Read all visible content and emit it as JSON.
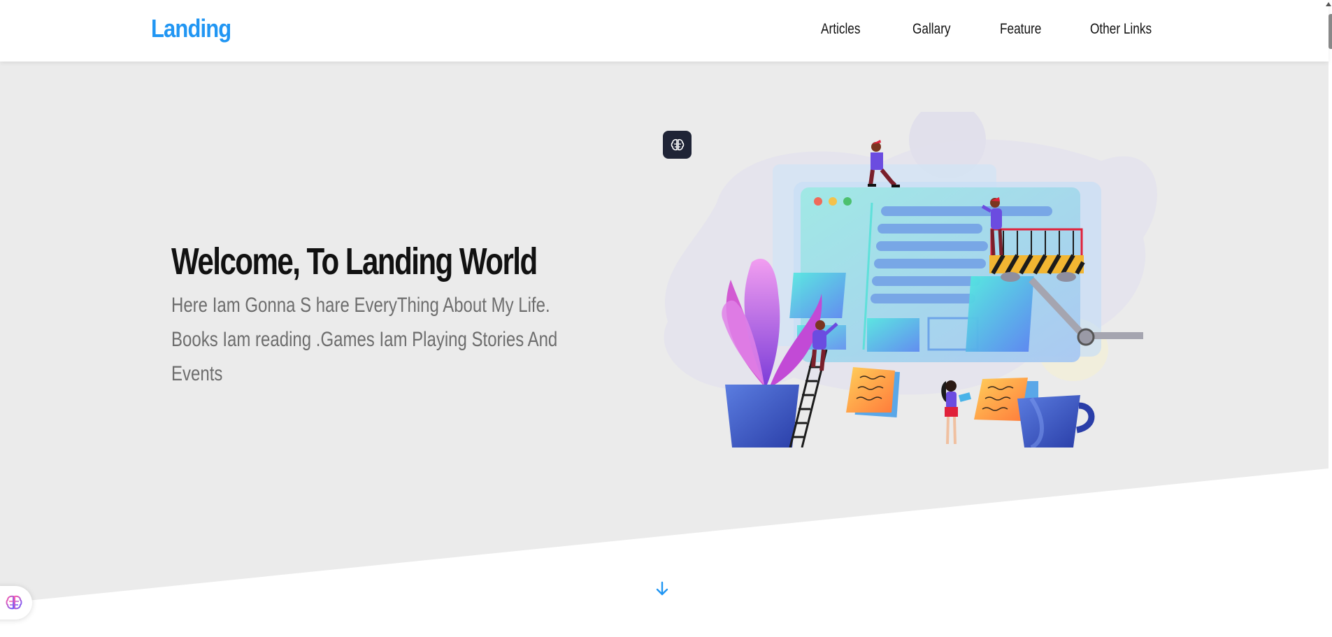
{
  "header": {
    "logo": "Landing",
    "nav": [
      "Articles",
      "Gallary",
      "Feature",
      "Other Links"
    ]
  },
  "hero": {
    "title": "Welcome, To Landing World",
    "subtitle": "Here Iam Gonna S hare EveryThing About My Life. Books Iam reading .Games Iam Playing Stories And Events"
  },
  "icons": {
    "brain_top": "brain-icon",
    "brain_float": "brain-icon",
    "scroll_down": "arrow-down-icon"
  },
  "colors": {
    "accent": "#2196f3",
    "hero_bg": "#ebebeb",
    "text_dark": "#111111",
    "text_muted": "#6d6d6d"
  }
}
